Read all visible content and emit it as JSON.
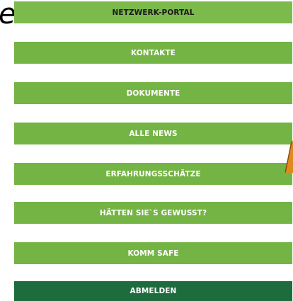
{
  "background": {
    "italic_text": "en"
  },
  "menu": {
    "items": [
      {
        "label": "NETZWERK-PORTAL",
        "active": true
      },
      {
        "label": "KONTAKTE"
      },
      {
        "label": "DOKUMENTE"
      },
      {
        "label": "ALLE NEWS"
      },
      {
        "label": "ERFAHRUNGSSCHÄTZE"
      },
      {
        "label": "HÄTTEN SIE`S GEWUSST?"
      },
      {
        "label": "KOMM SAFE"
      }
    ],
    "logout_label": "ABMELDEN"
  },
  "colors": {
    "menu_green": "#74b444",
    "logout_green": "#1e6b3e",
    "accent_orange": "#e08a1e"
  }
}
